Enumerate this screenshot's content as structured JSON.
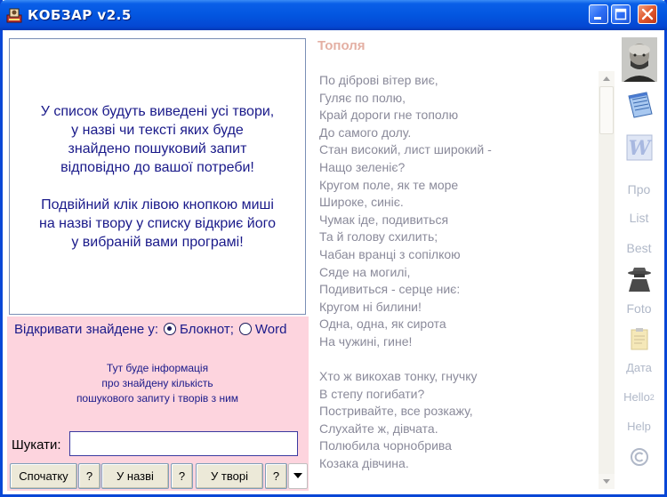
{
  "window": {
    "title": "КОБЗАР v2.5"
  },
  "info": {
    "paragraph1": [
      "У список будуть виведені усі твори,",
      "у назві чи тексті яких буде",
      "знайдено пошуковий запит",
      "відповідно до вашої потреби!"
    ],
    "paragraph2": [
      "Подвійний клік лівою кнопкою миші",
      "на назві твору у списку відкриє його",
      "у вибраній вами програмі!"
    ]
  },
  "open_with": {
    "label": "Відкривати знайдене у:",
    "option_notepad": "Блокнот;",
    "option_word": "Word",
    "selected": "notepad"
  },
  "result_info": [
    "Тут буде інформація",
    "про знайдену кількість",
    "пошукового запиту і творів з ним"
  ],
  "search": {
    "label": "Шукати:",
    "value": ""
  },
  "buttons": {
    "from_start": "Спочатку",
    "help": "?",
    "in_title": "У назві",
    "in_text": "У творі"
  },
  "poem": {
    "title": "Тополя",
    "lines": [
      "По діброві вітер виє,",
      "Гуляє по полю,",
      "Край дороги гне тополю",
      "До самого долу.",
      "Стан високий, лист широкий -",
      "Нащо зеленіє?",
      "Кругом поле, як те море",
      "Широке, синіє.",
      "Чумак іде, подивиться",
      "Та й голову схилить;",
      "Чабан вранці з сопілкою",
      "Сяде на могилі,",
      "Подивиться - серце ниє:",
      "Кругом ні билини!",
      "Одна, одна, як сирота",
      "На чужині, гине!",
      "",
      "Хто ж викохав тонку, гнучку",
      "В степу погибати?",
      "Постривайте, все розкажу,",
      "Слухайте ж, дівчата.",
      "Полюбила чорнобрива",
      "Козака дівчина."
    ]
  },
  "sidebar": {
    "about": "Про",
    "list": "List",
    "best": "Best",
    "foto": "Foto",
    "date": "Дата",
    "hello": "Hello",
    "hello_sup": "2",
    "help": "Help",
    "copyright": "©"
  },
  "colors": {
    "titlebar": "#0356e0",
    "pink_panel": "#fdd4de",
    "text_blue": "#1a1a8a",
    "poem_title": "#e4b0a4",
    "poem_text": "#8a8a9a"
  }
}
